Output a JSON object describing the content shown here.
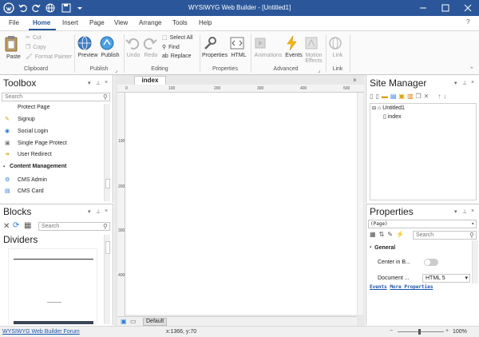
{
  "window": {
    "title": "WYSIWYG Web Builder - [Untitled1]"
  },
  "menu": {
    "tabs": [
      "File",
      "Home",
      "Insert",
      "Page",
      "View",
      "Arrange",
      "Tools",
      "Help"
    ]
  },
  "ribbon": {
    "clipboard": {
      "paste": "Paste",
      "cut": "Cut",
      "copy": "Copy",
      "format_painter": "Format Painter",
      "label": "Clipboard"
    },
    "publish": {
      "preview": "Preview",
      "publish": "Publish",
      "label": "Publish"
    },
    "editing": {
      "undo": "Undo",
      "redo": "Redo",
      "select_all": "Select All",
      "find": "Find",
      "replace": "Replace",
      "label": "Editing"
    },
    "properties": {
      "properties": "Properties",
      "html": "HTML",
      "label": "Properties"
    },
    "advanced": {
      "animations": "Animations",
      "events": "Events",
      "motion_effects_1": "Motion",
      "motion_effects_2": "Effects",
      "label": "Advanced"
    },
    "link": {
      "link": "Link",
      "label": "Link"
    }
  },
  "toolbox": {
    "title": "Toolbox",
    "search_placeholder": "Search",
    "items": [
      "Protect Page",
      "Signup",
      "Social Login",
      "Single Page Protect",
      "User Redirect"
    ],
    "section": "Content Management",
    "cms_items": [
      "CMS Admin",
      "CMS Card"
    ]
  },
  "blocks": {
    "title": "Blocks",
    "search_placeholder": "Search",
    "category": "Dividers"
  },
  "document": {
    "tab": "index",
    "ruler_top": [
      "0",
      "100",
      "200",
      "300",
      "400",
      "500"
    ],
    "ruler_left": [
      "100",
      "200",
      "300",
      "400"
    ],
    "bottom_tab": "Default"
  },
  "site_manager": {
    "title": "Site Manager",
    "root": "Untitled1",
    "page": "index"
  },
  "properties": {
    "title": "Properties",
    "selector": "(Page)",
    "search_placeholder": "Search",
    "section": "General",
    "rows": [
      {
        "label": "Center in B...",
        "value": ""
      },
      {
        "label": "Document ...",
        "value": "HTML 5"
      }
    ],
    "links": [
      "Events",
      "More Properties"
    ]
  },
  "status": {
    "forum_link": "WYSIWYG Web Builder Forum",
    "coords": "x:1366, y:70",
    "zoom": "100%"
  },
  "colors": {
    "accent": "#2b579a",
    "link": "#1a55b0"
  }
}
